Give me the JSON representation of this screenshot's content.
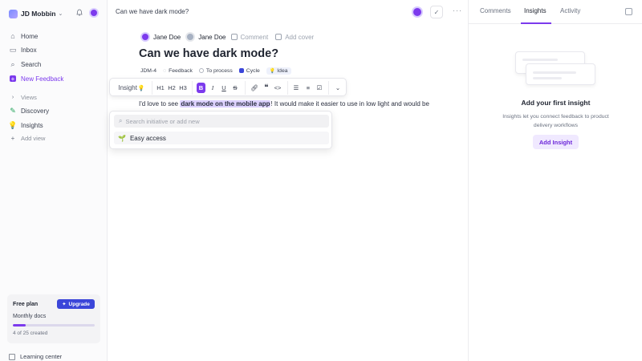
{
  "workspace": {
    "name": "JD Mobbin"
  },
  "sidebar": {
    "items": [
      {
        "label": "Home",
        "icon": "home-icon"
      },
      {
        "label": "Inbox",
        "icon": "inbox-icon"
      },
      {
        "label": "Search",
        "icon": "search-icon"
      },
      {
        "label": "New Feedback",
        "icon": "plus-icon"
      }
    ],
    "views_label": "Views",
    "views": [
      {
        "label": "Discovery",
        "icon": "pencil-icon"
      },
      {
        "label": "Insights",
        "icon": "lightbulb-icon"
      }
    ],
    "add_view": "Add view",
    "plan": {
      "title": "Free plan",
      "upgrade": "Upgrade",
      "docs_label": "Monthly docs",
      "count": "4 of 25 created",
      "progress": 0.16
    },
    "learning": "Learning center"
  },
  "header": {
    "title": "Can we have dark mode?"
  },
  "doc": {
    "people": [
      {
        "name": "Jane Doe"
      },
      {
        "name": "Jane Doe"
      }
    ],
    "comment_label": "Comment",
    "cover_label": "Add cover",
    "title": "Can we have dark mode?",
    "props": {
      "id": "JDM-4",
      "type": "Feedback",
      "status": "To process",
      "cycle": "Cycle",
      "tag": "Idea"
    },
    "body": {
      "before": "I'd love to see ",
      "highlight": "dark mode on the mobile app",
      "after": "! It would make it easier to use in low light and would be"
    }
  },
  "toolbar": {
    "insight_label": "Insight",
    "h1": "H1",
    "h2": "H2",
    "h3": "H3",
    "bold": "B",
    "italic": "I",
    "underline": "U",
    "strike": "S"
  },
  "dropdown": {
    "placeholder": "Search initiative or add new",
    "items": [
      {
        "label": "Easy access"
      }
    ]
  },
  "right_panel": {
    "tabs": [
      "Comments",
      "Insights",
      "Activity"
    ],
    "active_tab": "Insights",
    "title": "Add your first insight",
    "description": "Insights let you connect feedback to product delivery workflows",
    "button": "Add Insight"
  },
  "colors": {
    "accent": "#7c3aed",
    "upgrade_button": "#3b46d9",
    "highlight": "#ddd2ff"
  }
}
